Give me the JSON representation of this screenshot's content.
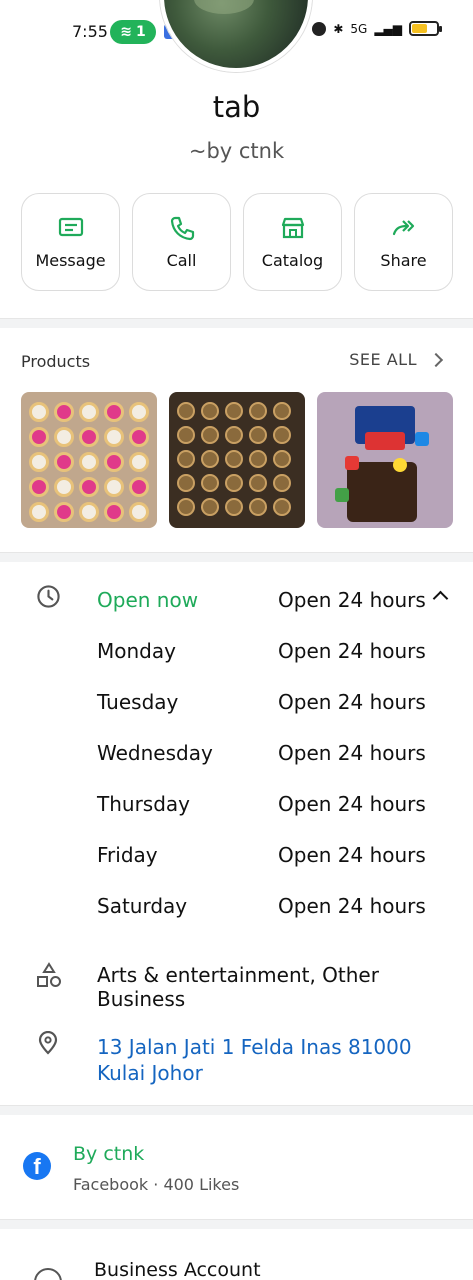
{
  "status_bar": {
    "time": "7:55",
    "wifi_badge": "1",
    "network": "5G"
  },
  "profile": {
    "name": "tab",
    "subtitle": "~by ctnk"
  },
  "actions": [
    {
      "label": "Message",
      "icon": "message-icon"
    },
    {
      "label": "Call",
      "icon": "phone-icon"
    },
    {
      "label": "Catalog",
      "icon": "store-icon"
    },
    {
      "label": "Share",
      "icon": "share-icon"
    }
  ],
  "products": {
    "title": "Products",
    "see_all": "SEE ALL",
    "items": [
      "cupcakes-tray",
      "chocolate-tarts-tray",
      "lego-birthday-cake"
    ]
  },
  "hours": {
    "status": "Open now",
    "status_hours": "Open 24 hours",
    "days": [
      {
        "day": "Monday",
        "hours": "Open 24 hours"
      },
      {
        "day": "Tuesday",
        "hours": "Open 24 hours"
      },
      {
        "day": "Wednesday",
        "hours": "Open 24 hours"
      },
      {
        "day": "Thursday",
        "hours": "Open 24 hours"
      },
      {
        "day": "Friday",
        "hours": "Open 24 hours"
      },
      {
        "day": "Saturday",
        "hours": "Open 24 hours"
      }
    ]
  },
  "category": "Arts & entertainment, Other Business",
  "address": "13 Jalan Jati 1 Felda Inas 81000 Kulai Johor",
  "facebook": {
    "name": "By ctnk",
    "meta": "Facebook · 400 Likes"
  },
  "business_account": "Business Account",
  "colors": {
    "accent_green": "#1faa5a",
    "link_blue": "#1565c0",
    "facebook_blue": "#1877f2"
  }
}
